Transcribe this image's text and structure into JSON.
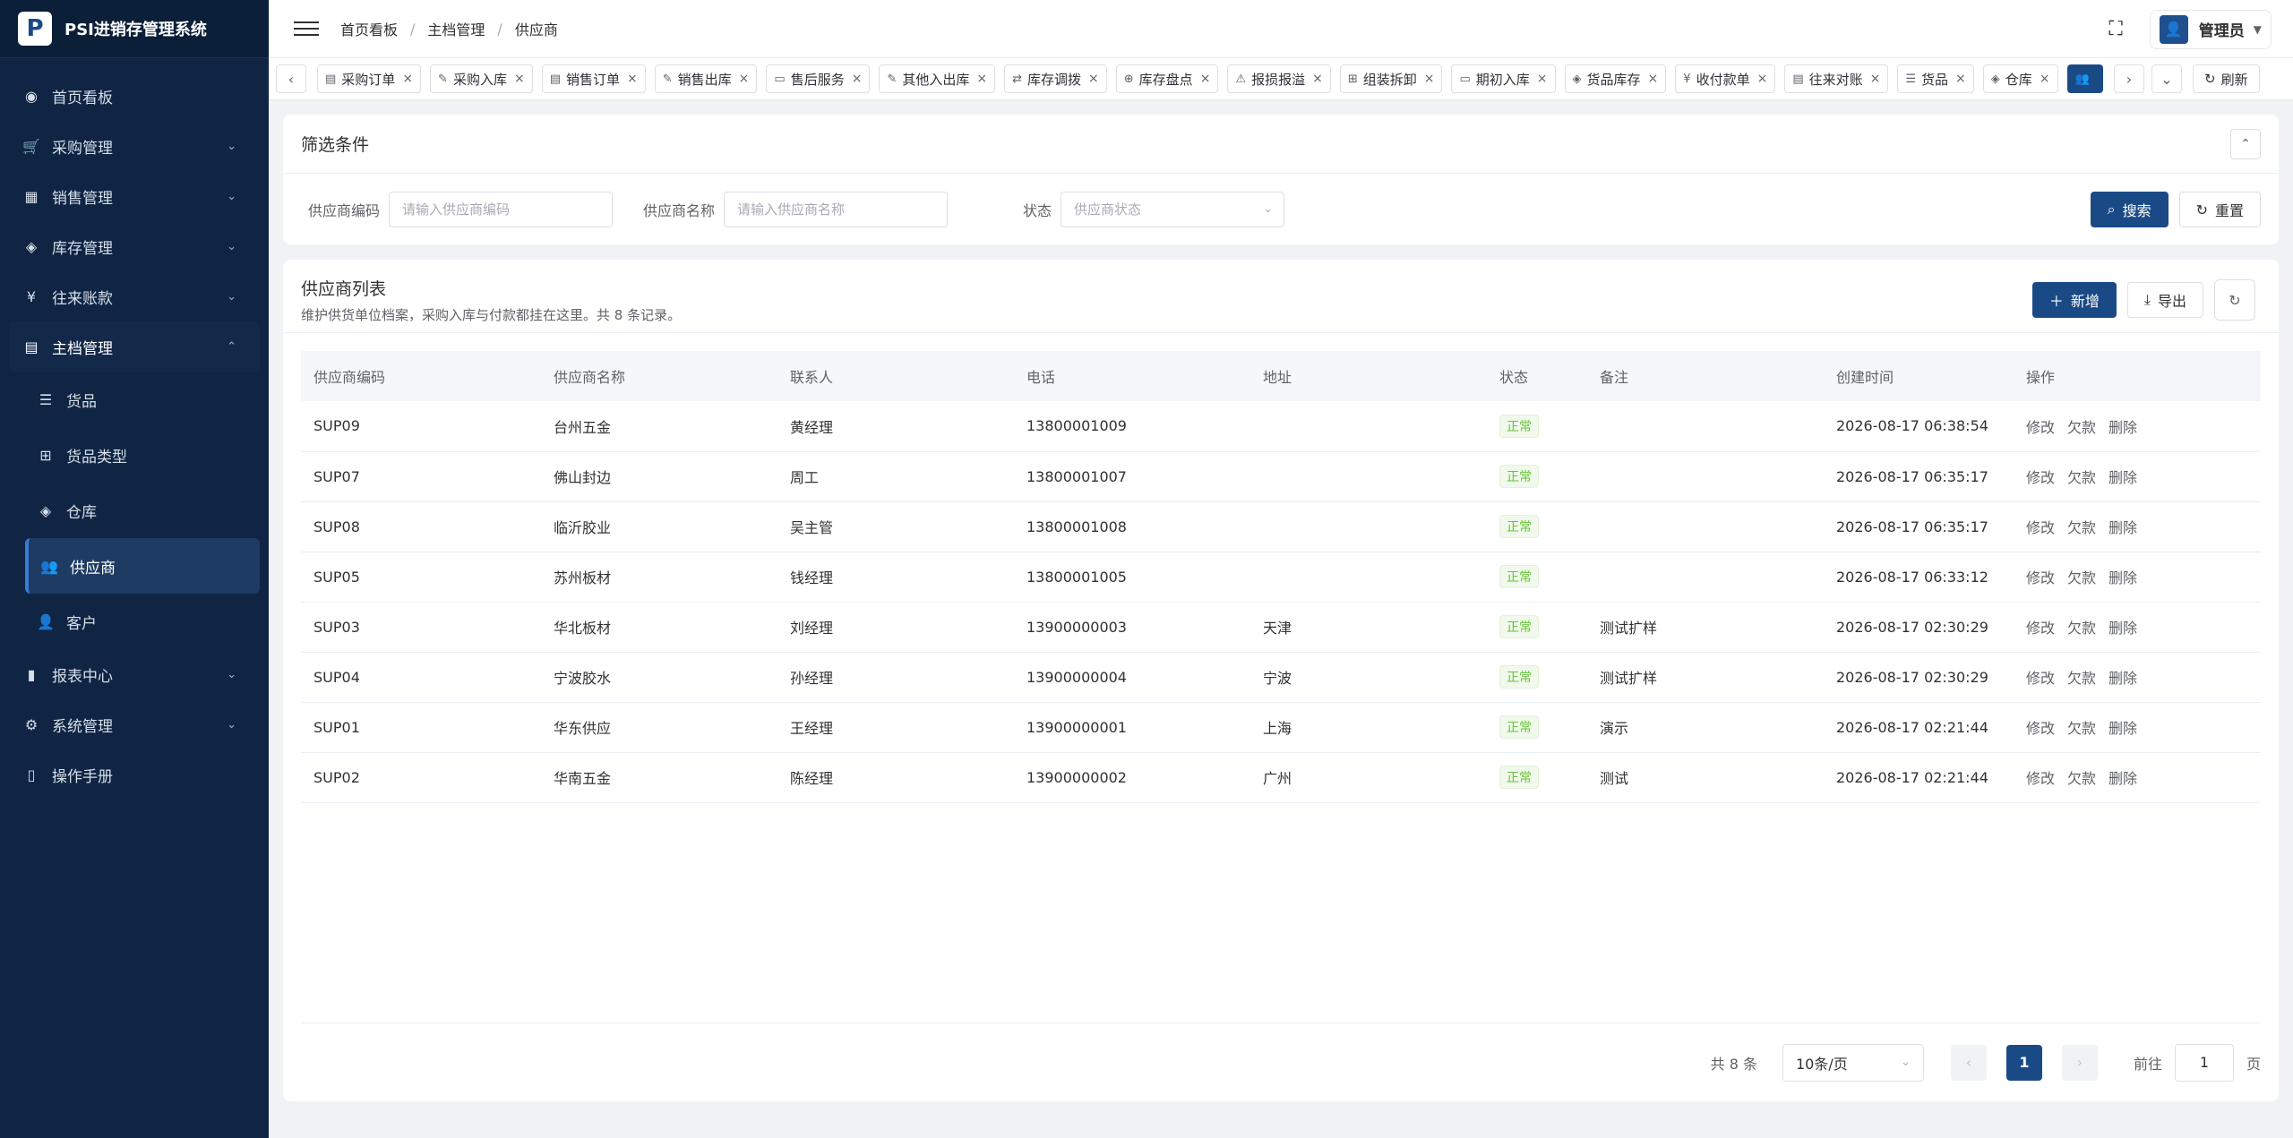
{
  "app": {
    "logo_letter": "P",
    "title": "PSI进销存管理系统"
  },
  "sidebar": {
    "items": [
      {
        "label": "首页看板",
        "icon": "dashboard-icon"
      },
      {
        "label": "采购管理",
        "icon": "cart-icon"
      },
      {
        "label": "销售管理",
        "icon": "sales-icon"
      },
      {
        "label": "库存管理",
        "icon": "inventory-icon"
      },
      {
        "label": "往来账款",
        "icon": "yen-icon"
      },
      {
        "label": "主档管理",
        "icon": "master-icon"
      },
      {
        "label": "报表中心",
        "icon": "chart-icon"
      },
      {
        "label": "系统管理",
        "icon": "gear-icon"
      },
      {
        "label": "操作手册",
        "icon": "book-icon"
      }
    ],
    "sub_items": [
      {
        "label": "货品"
      },
      {
        "label": "货品类型"
      },
      {
        "label": "仓库"
      },
      {
        "label": "供应商"
      },
      {
        "label": "客户"
      }
    ]
  },
  "header": {
    "breadcrumb": [
      "首页看板",
      "主档管理",
      "供应商"
    ],
    "user_name": "管理员"
  },
  "tabs": [
    "采购订单",
    "采购入库",
    "销售订单",
    "销售出库",
    "售后服务",
    "其他入出库",
    "库存调拨",
    "库存盘点",
    "报损报溢",
    "组装拆卸",
    "期初入库",
    "货品库存",
    "收付款单",
    "往来对账",
    "货品",
    "仓库"
  ],
  "tabs_refresh": "刷新",
  "filter": {
    "title": "筛选条件",
    "code_label": "供应商编码",
    "code_placeholder": "请输入供应商编码",
    "name_label": "供应商名称",
    "name_placeholder": "请输入供应商名称",
    "status_label": "状态",
    "status_placeholder": "供应商状态",
    "search_label": "搜索",
    "reset_label": "重置"
  },
  "list": {
    "title": "供应商列表",
    "desc": "维护供货单位档案，采购入库与付款都挂在这里。共 8 条记录。",
    "add_label": "新增",
    "export_label": "导出",
    "columns": [
      "供应商编码",
      "供应商名称",
      "联系人",
      "电话",
      "地址",
      "状态",
      "备注",
      "创建时间",
      "操作"
    ],
    "row_actions": [
      "修改",
      "欠款",
      "删除"
    ],
    "rows": [
      {
        "code": "SUP09",
        "name": "台州五金",
        "contact": "黄经理",
        "phone": "13800001009",
        "address": "",
        "status": "正常",
        "remark": "",
        "created": "2026-08-17 06:38:54"
      },
      {
        "code": "SUP07",
        "name": "佛山封边",
        "contact": "周工",
        "phone": "13800001007",
        "address": "",
        "status": "正常",
        "remark": "",
        "created": "2026-08-17 06:35:17"
      },
      {
        "code": "SUP08",
        "name": "临沂胶业",
        "contact": "吴主管",
        "phone": "13800001008",
        "address": "",
        "status": "正常",
        "remark": "",
        "created": "2026-08-17 06:35:17"
      },
      {
        "code": "SUP05",
        "name": "苏州板材",
        "contact": "钱经理",
        "phone": "13800001005",
        "address": "",
        "status": "正常",
        "remark": "",
        "created": "2026-08-17 06:33:12"
      },
      {
        "code": "SUP03",
        "name": "华北板材",
        "contact": "刘经理",
        "phone": "13900000003",
        "address": "天津",
        "status": "正常",
        "remark": "测试扩样",
        "created": "2026-08-17 02:30:29"
      },
      {
        "code": "SUP04",
        "name": "宁波胶水",
        "contact": "孙经理",
        "phone": "13900000004",
        "address": "宁波",
        "status": "正常",
        "remark": "测试扩样",
        "created": "2026-08-17 02:30:29"
      },
      {
        "code": "SUP01",
        "name": "华东供应",
        "contact": "王经理",
        "phone": "13900000001",
        "address": "上海",
        "status": "正常",
        "remark": "演示",
        "created": "2026-08-17 02:21:44"
      },
      {
        "code": "SUP02",
        "name": "华南五金",
        "contact": "陈经理",
        "phone": "13900000002",
        "address": "广州",
        "status": "正常",
        "remark": "测试",
        "created": "2026-08-17 02:21:44"
      }
    ]
  },
  "pager": {
    "total": "共 8 条",
    "page_size": "10条/页",
    "current": "1",
    "goto_label": "前往",
    "goto_value": "1",
    "page_suffix": "页"
  },
  "colors": {
    "sidebar_bg": "#0f2543",
    "primary": "#1a4a86",
    "status_green": "#67c23a"
  }
}
